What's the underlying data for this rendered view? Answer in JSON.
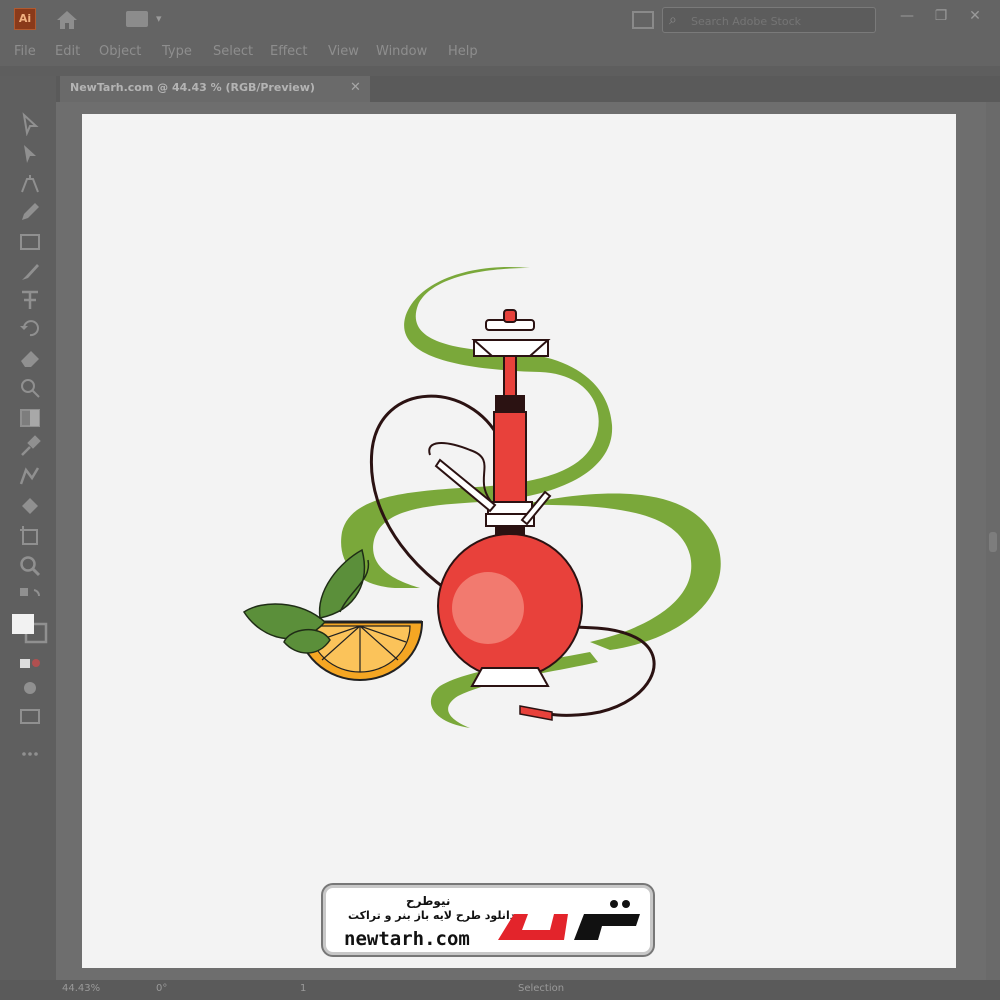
{
  "window": {
    "app_icon": "Ai",
    "icons": [
      "illustrator-app-icon",
      "home-icon",
      "workspace-switcher-icon",
      "arrange-documents-icon",
      "search-icon"
    ],
    "search_placeholder": "Search Adobe Stock",
    "controls": {
      "minimize": "—",
      "restore": "❐",
      "close": "✕"
    }
  },
  "menu": {
    "items": [
      "File",
      "Edit",
      "Object",
      "Type",
      "Select",
      "Effect",
      "View",
      "Window",
      "Help"
    ]
  },
  "document": {
    "tab_title": "NewTarh.com @ 44.43 % (RGB/Preview)",
    "close_glyph": "✕"
  },
  "tools": [
    "selection-tool-icon",
    "direct-selection-tool-icon",
    "pen-tool-icon",
    "pencil-tool-icon",
    "rectangle-tool-icon",
    "paintbrush-tool-icon",
    "type-tool-icon",
    "rotate-tool-icon",
    "eraser-tool-icon",
    "shape-builder-tool-icon",
    "gradient-tool-icon",
    "eyedropper-tool-icon",
    "blend-tool-icon",
    "symbol-sprayer-tool-icon",
    "artboard-tool-icon",
    "zoom-tool-icon",
    "swap-fill-stroke-icon",
    "fill-stroke-swatch-icon",
    "draw-mode-icon",
    "screen-mode-icon",
    "more-tools-icon"
  ],
  "status": {
    "zoom": "44.43%",
    "rotation": "0°",
    "page": "1",
    "tool": "Selection"
  },
  "watermark": {
    "line1": "نیوطرح",
    "line2": "دانلود طرح لایه باز بنر و تراکت",
    "url": "newtarh.com",
    "brand": "نیوطرح"
  },
  "colors": {
    "ui_dark": "#5f5f5f",
    "artboard": "#f3f3f3",
    "smoke_green": "#7aa83a",
    "hookah_red": "#e8413b",
    "orange": "#f5a623",
    "leaf_green": "#5b8f3a",
    "brand_red": "#e3242b"
  }
}
